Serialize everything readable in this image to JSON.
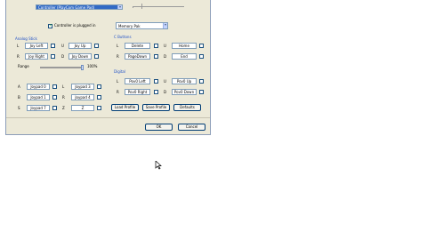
{
  "controller_select": {
    "value": "Controller (PlayCom Game Pad)"
  },
  "plugged": {
    "label": "Controller is plugged in",
    "checked": true
  },
  "pak_select": {
    "value": "Memory Pak"
  },
  "analog": {
    "title": "Analog Stick",
    "rows": [
      {
        "l1": "L",
        "v1": "Joy Left",
        "l2": "U",
        "v2": "Joy Up"
      },
      {
        "l1": "R",
        "v1": "Joy Right",
        "l2": "D",
        "v2": "Joy Down"
      }
    ],
    "range_label": "Range",
    "range_value": "100%"
  },
  "cbuttons": {
    "title": "C Buttons",
    "rows": [
      {
        "l1": "L",
        "v1": "Delete",
        "l2": "U",
        "v2": "Home"
      },
      {
        "l1": "R",
        "v1": "PageDown",
        "l2": "D",
        "v2": "End"
      }
    ]
  },
  "buttons": {
    "rows": [
      {
        "l1": "A",
        "v1": "Joypad 0",
        "l2": "L",
        "v2": "Joypad 3"
      },
      {
        "l1": "B",
        "v1": "Joypad 1",
        "l2": "R",
        "v2": "Joypad 4"
      },
      {
        "l1": "S",
        "v1": "Joypad 7",
        "l2": "Z",
        "v2": "Z"
      }
    ]
  },
  "digital": {
    "title": "Digital",
    "rows": [
      {
        "l1": "L",
        "v1": "Pov0 Left",
        "l2": "U",
        "v2": "Pov0 Up"
      },
      {
        "l1": "R",
        "v1": "Pov0 Right",
        "l2": "D",
        "v2": "Pov0 Down"
      }
    ]
  },
  "profile_buttons": {
    "load": "Load Profile",
    "save": "Save Profile",
    "defaults": "Defaults"
  },
  "dialog_buttons": {
    "ok": "OK",
    "cancel": "Cancel"
  }
}
